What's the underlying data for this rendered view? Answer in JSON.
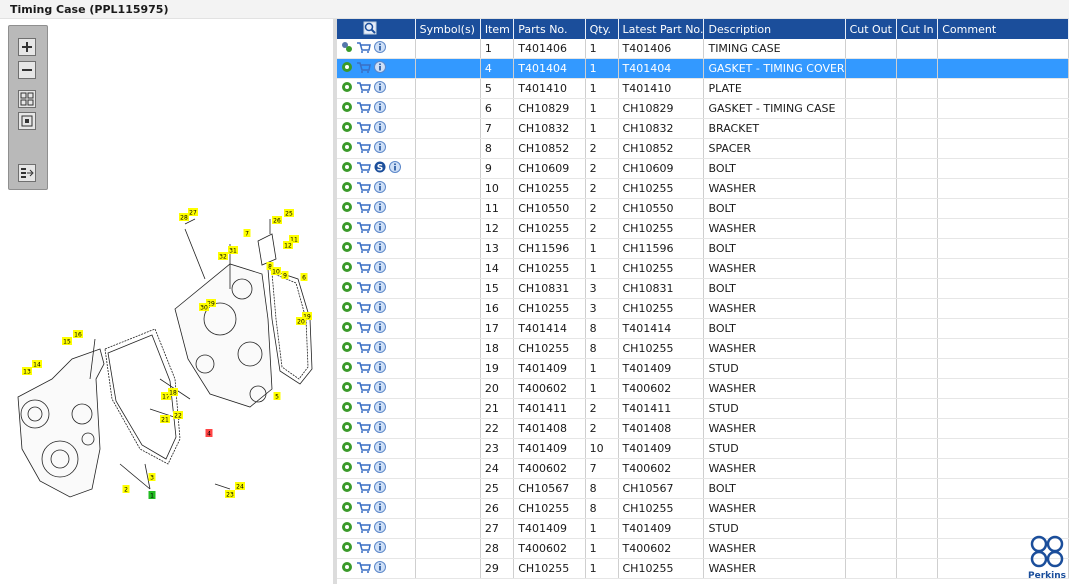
{
  "title": "Timing Case (PPL115975)",
  "toolbar": {
    "items": [
      "zoom-in-icon",
      "zoom-out-icon",
      "fit-all-icon",
      "fit-window-icon",
      "toggle-list-icon"
    ]
  },
  "columns": [
    "",
    "Symbol(s)",
    "Item",
    "Parts No.",
    "Qty.",
    "Latest Part No.",
    "Description",
    "Cut Out",
    "Cut In",
    "Comment"
  ],
  "rows": [
    {
      "item": "1",
      "part": "T401406",
      "qty": "1",
      "latest": "T401406",
      "desc": "TIMING CASE",
      "special": "parts-icon"
    },
    {
      "item": "4",
      "part": "T401404",
      "qty": "1",
      "latest": "T401404",
      "desc": "GASKET - TIMING COVER",
      "selected": true
    },
    {
      "item": "5",
      "part": "T401410",
      "qty": "1",
      "latest": "T401410",
      "desc": "PLATE"
    },
    {
      "item": "6",
      "part": "CH10829",
      "qty": "1",
      "latest": "CH10829",
      "desc": "GASKET - TIMING CASE"
    },
    {
      "item": "7",
      "part": "CH10832",
      "qty": "1",
      "latest": "CH10832",
      "desc": "BRACKET"
    },
    {
      "item": "8",
      "part": "CH10852",
      "qty": "2",
      "latest": "CH10852",
      "desc": "SPACER"
    },
    {
      "item": "9",
      "part": "CH10609",
      "qty": "2",
      "latest": "CH10609",
      "desc": "BOLT",
      "special": "s-badge"
    },
    {
      "item": "10",
      "part": "CH10255",
      "qty": "2",
      "latest": "CH10255",
      "desc": "WASHER"
    },
    {
      "item": "11",
      "part": "CH10550",
      "qty": "2",
      "latest": "CH10550",
      "desc": "BOLT"
    },
    {
      "item": "12",
      "part": "CH10255",
      "qty": "2",
      "latest": "CH10255",
      "desc": "WASHER"
    },
    {
      "item": "13",
      "part": "CH11596",
      "qty": "1",
      "latest": "CH11596",
      "desc": "BOLT"
    },
    {
      "item": "14",
      "part": "CH10255",
      "qty": "1",
      "latest": "CH10255",
      "desc": "WASHER"
    },
    {
      "item": "15",
      "part": "CH10831",
      "qty": "3",
      "latest": "CH10831",
      "desc": "BOLT"
    },
    {
      "item": "16",
      "part": "CH10255",
      "qty": "3",
      "latest": "CH10255",
      "desc": "WASHER"
    },
    {
      "item": "17",
      "part": "T401414",
      "qty": "8",
      "latest": "T401414",
      "desc": "BOLT"
    },
    {
      "item": "18",
      "part": "CH10255",
      "qty": "8",
      "latest": "CH10255",
      "desc": "WASHER"
    },
    {
      "item": "19",
      "part": "T401409",
      "qty": "1",
      "latest": "T401409",
      "desc": "STUD"
    },
    {
      "item": "20",
      "part": "T400602",
      "qty": "1",
      "latest": "T400602",
      "desc": "WASHER"
    },
    {
      "item": "21",
      "part": "T401411",
      "qty": "2",
      "latest": "T401411",
      "desc": "STUD"
    },
    {
      "item": "22",
      "part": "T401408",
      "qty": "2",
      "latest": "T401408",
      "desc": "WASHER"
    },
    {
      "item": "23",
      "part": "T401409",
      "qty": "10",
      "latest": "T401409",
      "desc": "STUD"
    },
    {
      "item": "24",
      "part": "T400602",
      "qty": "7",
      "latest": "T400602",
      "desc": "WASHER"
    },
    {
      "item": "25",
      "part": "CH10567",
      "qty": "8",
      "latest": "CH10567",
      "desc": "BOLT"
    },
    {
      "item": "26",
      "part": "CH10255",
      "qty": "8",
      "latest": "CH10255",
      "desc": "WASHER"
    },
    {
      "item": "27",
      "part": "T401409",
      "qty": "1",
      "latest": "T401409",
      "desc": "STUD"
    },
    {
      "item": "28",
      "part": "T400602",
      "qty": "1",
      "latest": "T400602",
      "desc": "WASHER"
    },
    {
      "item": "29",
      "part": "CH10255",
      "qty": "1",
      "latest": "CH10255",
      "desc": "WASHER"
    }
  ],
  "callouts": [
    "1",
    "2",
    "3",
    "4",
    "5",
    "6",
    "7",
    "8",
    "9",
    "10",
    "11",
    "12",
    "13",
    "14",
    "15",
    "16",
    "17",
    "18",
    "19",
    "20",
    "21",
    "22",
    "23",
    "24",
    "25",
    "26",
    "27",
    "28",
    "29",
    "30",
    "31",
    "32"
  ],
  "logo_text": "Perkins",
  "colors": {
    "header": "#1b4e9b",
    "selected": "#3399ff",
    "callout": "#ffff00",
    "gear": "#3a9a2a",
    "cart": "#3a6fc4"
  }
}
